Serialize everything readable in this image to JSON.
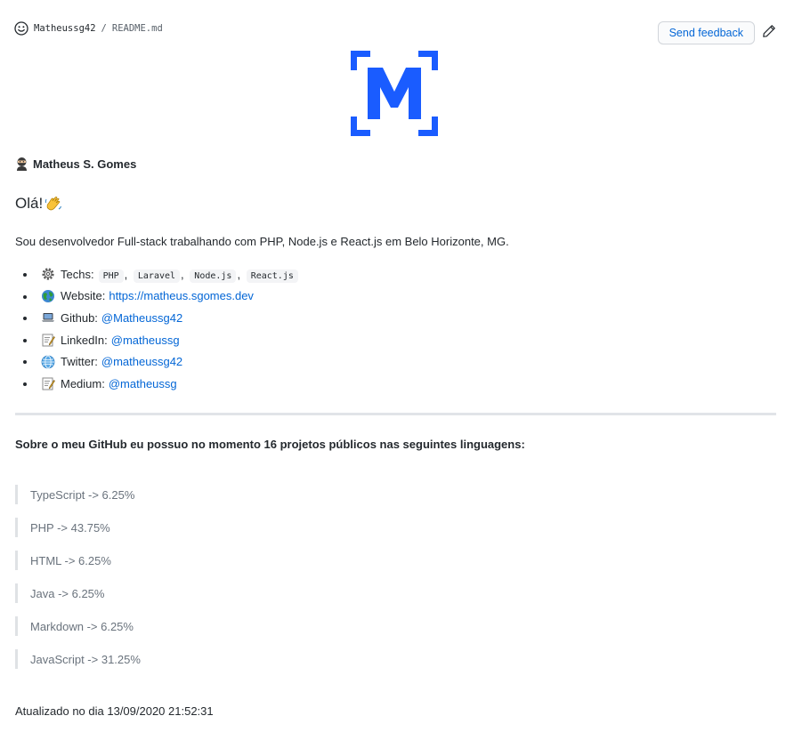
{
  "header": {
    "repo": "Matheussg42",
    "separator": "/",
    "file": "README.md",
    "feedback_label": "Send feedback",
    "icons": [
      "smiley-icon",
      "pencil-icon"
    ]
  },
  "profile": {
    "author": "Matheus S. Gomes",
    "greeting": "Olá!",
    "intro": "Sou desenvolvedor Full-stack trabalhando com PHP, Node.js e React.js em Belo Horizonte, MG."
  },
  "links": {
    "techs_label": "Techs:",
    "techs": [
      "PHP",
      "Laravel",
      "Node.js",
      "React.js"
    ],
    "website_label": "Website:",
    "website_url": "https://matheus.sgomes.dev",
    "github_label": "Github:",
    "github_handle": "@Matheussg42",
    "linkedin_label": "LinkedIn:",
    "linkedin_handle": "@matheussg",
    "twitter_label": "Twitter:",
    "twitter_handle": "@matheussg42",
    "medium_label": "Medium:",
    "medium_handle": "@matheussg"
  },
  "languages": {
    "summary": "Sobre o meu GitHub eu possuo no momento 16 projetos públicos nas seguintes linguagens:",
    "items": [
      "TypeScript -> 6.25%",
      "PHP -> 43.75%",
      "HTML -> 6.25%",
      "Java -> 6.25%",
      "Markdown -> 6.25%",
      "JavaScript -> 31.25%"
    ]
  },
  "footer": {
    "updated": "Atualizado no dia 13/09/2020 21:52:31"
  },
  "colors": {
    "brand_blue": "#1a5cff",
    "link": "#0366d6"
  }
}
